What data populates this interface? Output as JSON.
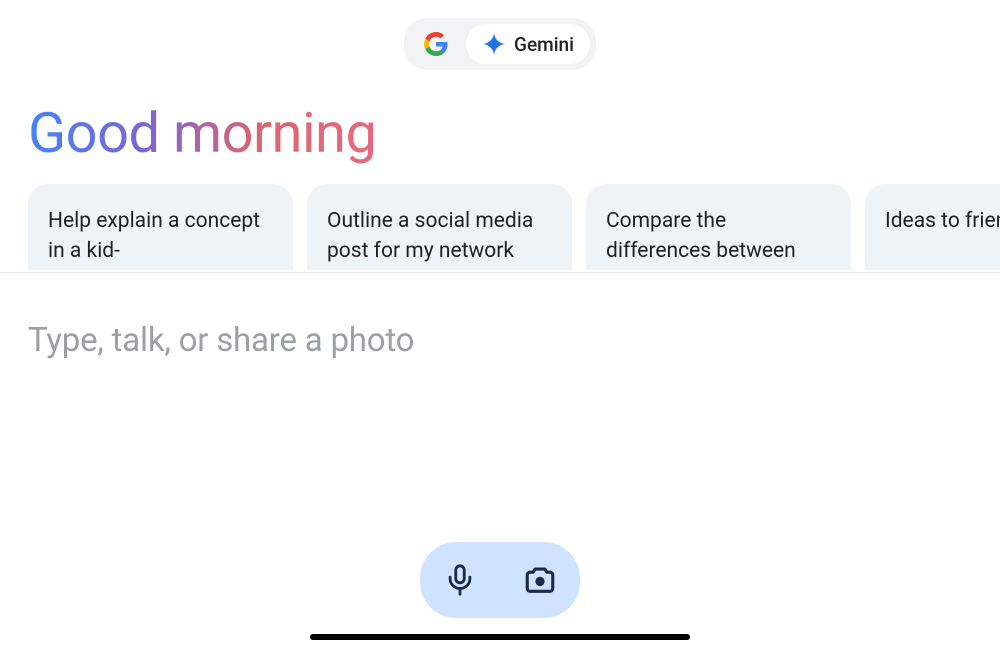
{
  "mode_toggle": {
    "google_label": "Google",
    "gemini_label": "Gemini",
    "active": "gemini"
  },
  "greeting": "Good morning",
  "suggestions": [
    {
      "text": "Help explain a concept in a kid-"
    },
    {
      "text": "Outline a social media post for my network"
    },
    {
      "text": "Compare the differences between"
    },
    {
      "text": "Ideas to friend o"
    }
  ],
  "input": {
    "placeholder": "Type, talk, or share a photo"
  },
  "actions": {
    "mic_label": "Voice input",
    "camera_label": "Camera input"
  },
  "colors": {
    "gradient_start": "#4285f4",
    "gradient_end": "#e66a7e",
    "card_bg": "#eef3f8",
    "pill_bg": "#cfe2ff",
    "placeholder": "#9aa0a6"
  }
}
